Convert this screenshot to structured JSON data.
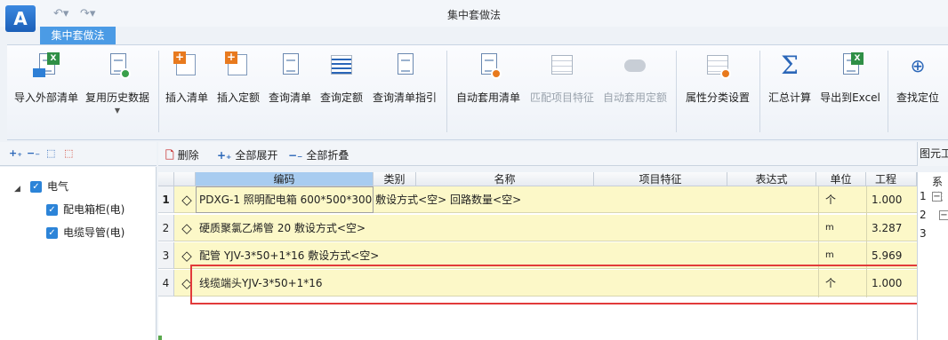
{
  "window": {
    "title": "集中套做法",
    "logo_letter": "A"
  },
  "quick_access": {
    "undo_icon": "undo-icon",
    "redo_icon": "redo-icon"
  },
  "ribbon_tab": "集中套做法",
  "ribbon": {
    "import_external": "导入外部清单",
    "reuse_history": "复用历史数据",
    "insert_list": "插入清单",
    "insert_quota": "插入定额",
    "query_list": "查询清单",
    "query_quota": "查询定额",
    "query_list_guide": "查询清单指引",
    "auto_apply_list": "自动套用清单",
    "match_item_feature": "匹配项目特征",
    "auto_apply_quota": "自动套用定额",
    "attr_category_settings": "属性分类设置",
    "summary_calc": "汇总计算",
    "export_excel": "导出到Excel",
    "find_locate": "查找定位"
  },
  "tree": {
    "items": [
      {
        "label": "电气",
        "checked": true
      },
      {
        "label": "配电箱柜(电)",
        "checked": true
      },
      {
        "label": "电缆导管(电)",
        "checked": true
      }
    ]
  },
  "main_toolbar": {
    "delete": "删除",
    "expand_all": "全部展开",
    "collapse_all": "全部折叠"
  },
  "table": {
    "columns": [
      "编码",
      "类别",
      "名称",
      "项目特征",
      "表达式",
      "单位",
      "工程量"
    ],
    "header_visible": {
      "quantity": "工程"
    },
    "rows": [
      {
        "num": "1",
        "name": "PDXG-1 照明配电箱 600*500*300 敷设方式<空> 回路数量<空>",
        "unit": "个",
        "qty": "1.000"
      },
      {
        "num": "2",
        "name": "硬质聚氯乙烯管 20 敷设方式<空>",
        "unit": "m",
        "qty": "3.287"
      },
      {
        "num": "3",
        "name": "配管 YJV-3*50+1*16 敷设方式<空>",
        "unit": "m",
        "qty": "5.969"
      },
      {
        "num": "4",
        "name": "线缆端头YJV-3*50+1*16",
        "unit": "个",
        "qty": "1.000"
      }
    ]
  },
  "right_panel": {
    "title": "图元工",
    "header": "系统",
    "rows": [
      "1",
      "2",
      "3"
    ]
  }
}
